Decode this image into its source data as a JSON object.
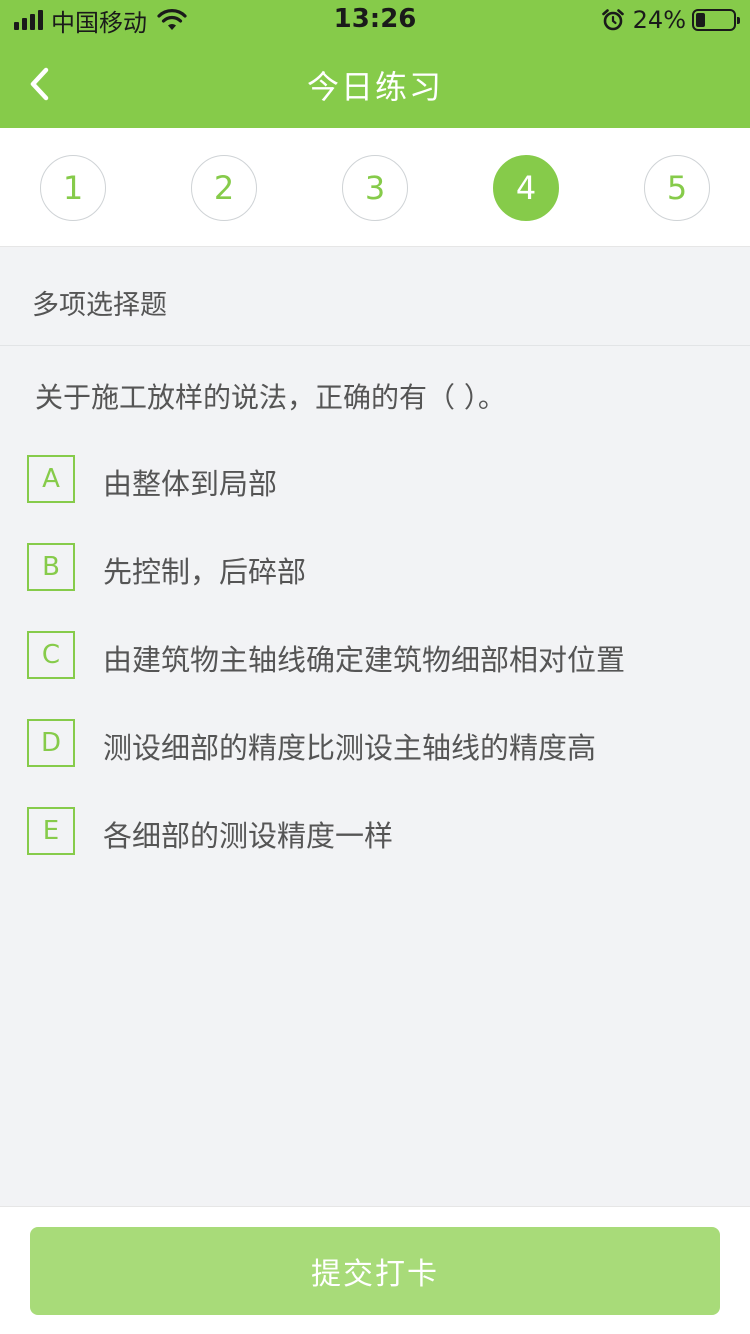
{
  "status_bar": {
    "carrier": "中国移动",
    "time": "13:26",
    "battery_text": "24%",
    "battery_level": 0.24,
    "icons": [
      "signal-icon",
      "wifi-icon",
      "alarm-icon",
      "battery-icon"
    ]
  },
  "nav": {
    "title": "今日练习",
    "back_icon": "chevron-left-icon"
  },
  "question_nav": {
    "numbers": [
      "1",
      "2",
      "3",
      "4",
      "5"
    ],
    "active": "4"
  },
  "question": {
    "type": "多项选择题",
    "stem": "关于施工放样的说法，正确的有（    ）。",
    "options": [
      {
        "key": "A",
        "text": "由整体到局部"
      },
      {
        "key": "B",
        "text": "先控制，后碎部"
      },
      {
        "key": "C",
        "text": "由建筑物主轴线确定建筑物细部相对位置"
      },
      {
        "key": "D",
        "text": "测设细部的精度比测设主轴线的精度高"
      },
      {
        "key": "E",
        "text": "各细部的测设精度一样"
      }
    ]
  },
  "footer": {
    "submit_label": "提交打卡"
  },
  "colors": {
    "accent": "#86cb4a",
    "submit_bg": "#a8db79",
    "page_bg": "#f2f3f5",
    "text": "#555555"
  }
}
